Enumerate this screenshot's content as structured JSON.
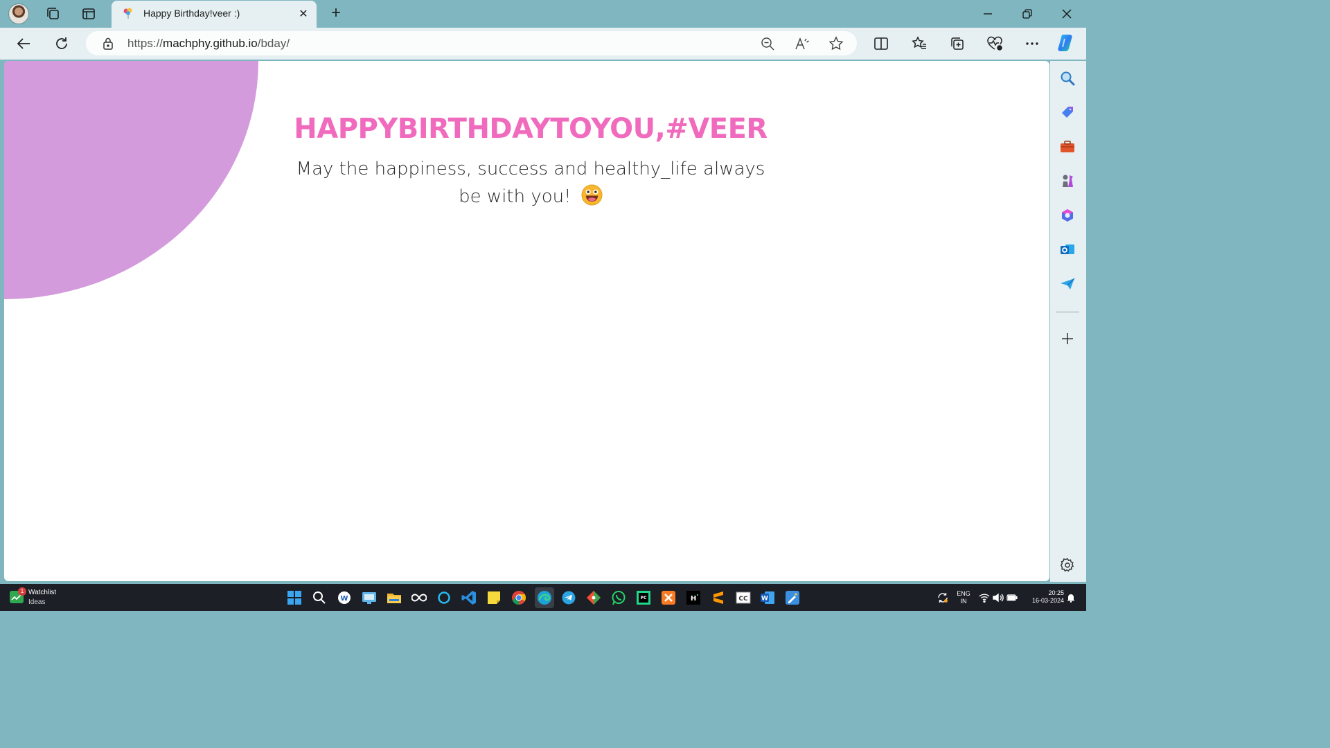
{
  "browser": {
    "tab_title": "Happy Birthday!veer :)",
    "tab_close_icon": "close-icon",
    "new_tab_icon": "plus-icon",
    "url_scheme": "https://",
    "url_host": "machphy.github.io",
    "url_path": "/bday/"
  },
  "page": {
    "headline": "HAPPYBIRTHDAYTOYOU,#VEER",
    "message_line1": "May the happiness, success and healthy_life always",
    "message_line2": "be with you!",
    "accent_color": "#f06bbd",
    "circle_color": "#d39adc"
  },
  "taskbar": {
    "widget_title": "Watchlist",
    "widget_subtitle": "Ideas",
    "widget_badge": "1",
    "language": "ENG",
    "region": "IN",
    "time": "20:25",
    "date": "16-03-2024"
  }
}
